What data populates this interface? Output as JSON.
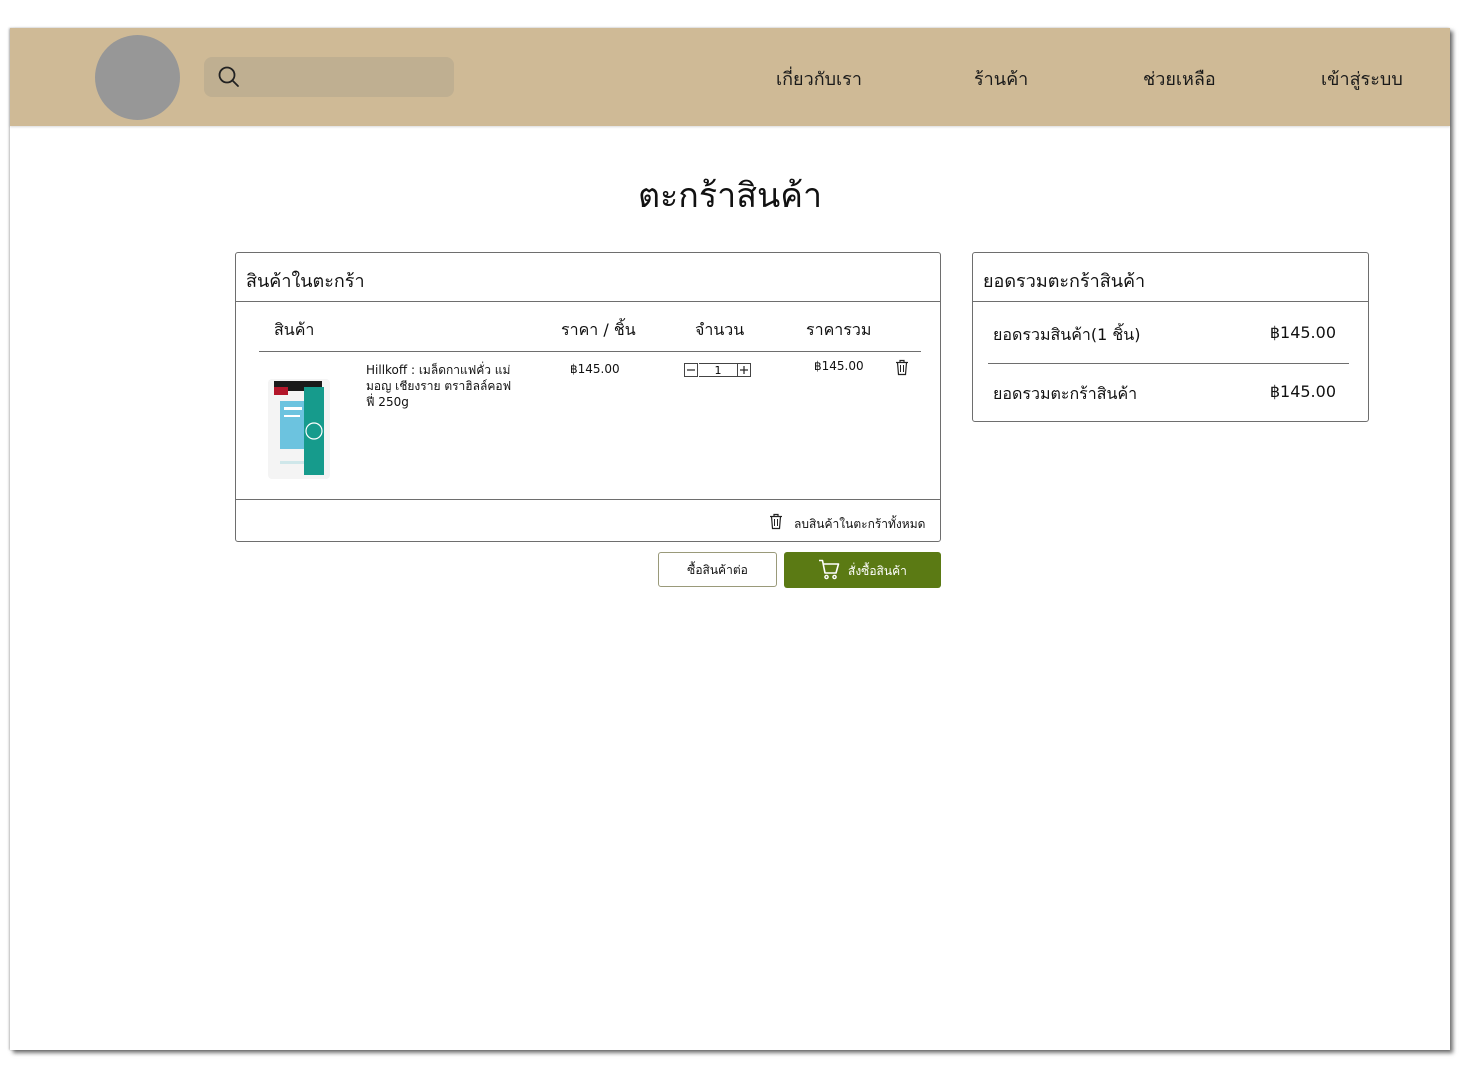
{
  "header": {
    "search_placeholder": "",
    "nav": [
      "เกี่ยวกับเรา",
      "ร้านค้า",
      "ช่วยเหลือ",
      "เข้าสู่ระบบ"
    ]
  },
  "page": {
    "title": "ตะกร้าสินค้า"
  },
  "cart": {
    "title": "สินค้าในตะกร้า",
    "columns": {
      "product": "สินค้า",
      "unit_price": "ราคา / ชิ้น",
      "quantity": "จำนวน",
      "total": "ราคารวม"
    },
    "items": [
      {
        "name": "Hillkoff : เมล็ดกาแฟคั่ว แม่มอญ เชียงราย ตราฮิลล์คอฟฟี่ 250g",
        "unit_price": "฿145.00",
        "quantity": "1",
        "total": "฿145.00"
      }
    ],
    "clear_all_label": "ลบสินค้าในตะกร้าทั้งหมด"
  },
  "actions": {
    "continue_label": "ซื้อสินค้าต่อ",
    "order_label": "สั่งซื้อสินค้า"
  },
  "summary": {
    "title": "ยอดรวมตะกร้าสินค้า",
    "rows": [
      {
        "label": "ยอดรวมสินค้า(1 ชิ้น)",
        "value": "฿145.00"
      },
      {
        "label": "ยอดรวมตะกร้าสินค้า",
        "value": "฿145.00"
      }
    ]
  },
  "icons": {
    "search": "search-icon",
    "trash": "trash-icon",
    "cart": "cart-icon",
    "minus": "minus-icon",
    "plus": "plus-icon"
  },
  "colors": {
    "header_bg": "#cfba96",
    "search_bg": "#bfaf91",
    "logo": "#979797",
    "primary_button": "#5b7a14"
  }
}
